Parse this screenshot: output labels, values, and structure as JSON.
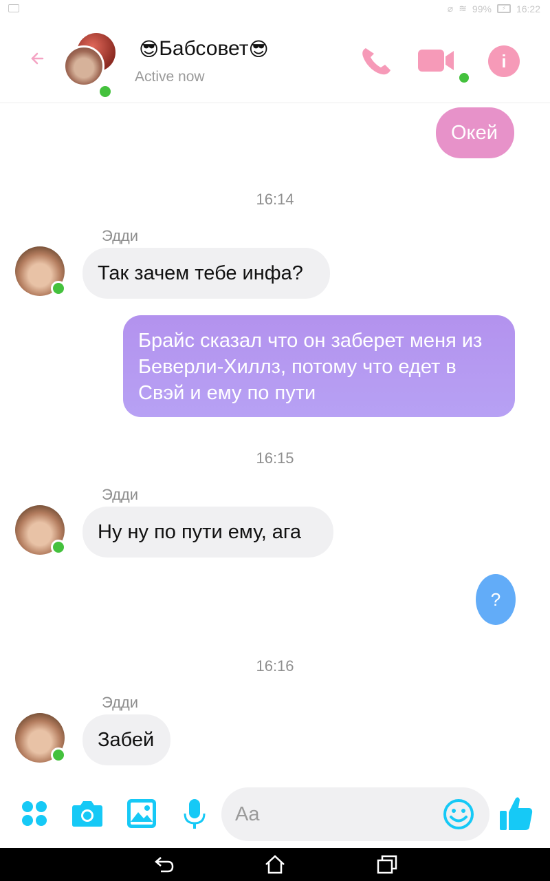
{
  "status_bar": {
    "battery": "99%",
    "time": "16:22"
  },
  "header": {
    "title_prefix_emoji": "😎",
    "title": "Бабсовет",
    "title_suffix_emoji": "😎",
    "status": "Active now"
  },
  "messages": [
    {
      "type": "outgoing",
      "style": "pink",
      "text": "Окей"
    },
    {
      "type": "timestamp",
      "text": "16:14"
    },
    {
      "type": "incoming",
      "sender": "Эдди",
      "text": "Так зачем тебе инфа?"
    },
    {
      "type": "outgoing",
      "style": "purple",
      "text": "Брайс сказал что он заберет меня из Беверли-Хиллз, потому что едет в Свэй и ему по пути"
    },
    {
      "type": "timestamp",
      "text": "16:15"
    },
    {
      "type": "incoming",
      "sender": "Эдди",
      "text": "Ну ну по пути ему, ага"
    },
    {
      "type": "outgoing",
      "style": "blue",
      "text": "?"
    },
    {
      "type": "timestamp",
      "text": "16:16"
    },
    {
      "type": "incoming",
      "sender": "Эдди",
      "text": "Забей"
    }
  ],
  "composer": {
    "placeholder": "Aa"
  },
  "colors": {
    "accent_pink": "#f69ab8",
    "accent_cyan": "#16c9f6",
    "online_green": "#44c13d"
  }
}
